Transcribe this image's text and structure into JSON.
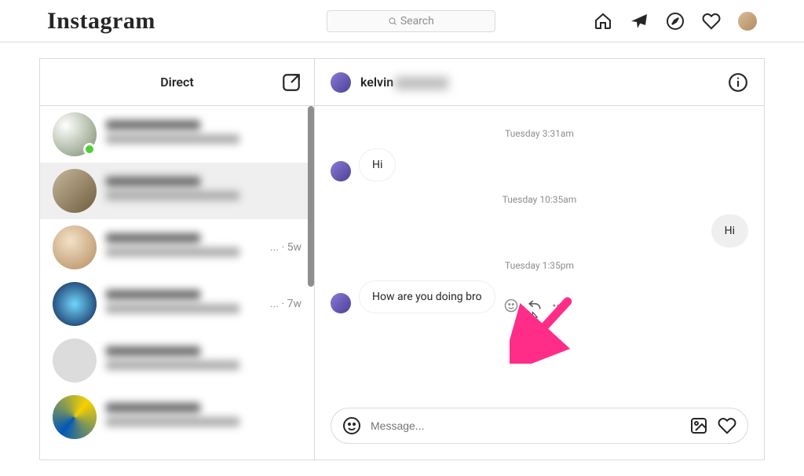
{
  "header": {
    "logo_text": "Instagram",
    "search_placeholder": "Search"
  },
  "sidebar": {
    "title": "Direct",
    "threads": [
      {
        "meta": "",
        "online": true,
        "avatar": "photo1"
      },
      {
        "meta": "",
        "selected": true,
        "avatar": "photo2"
      },
      {
        "meta": "... · 5w",
        "avatar": "photo3"
      },
      {
        "meta": "... · 7w",
        "avatar": "photo4"
      },
      {
        "meta": "",
        "avatar": "blank"
      },
      {
        "meta": "",
        "avatar": "photo5"
      }
    ]
  },
  "chat": {
    "name_visible": "kelvin",
    "timestamps": {
      "t1": "Tuesday 3:31am",
      "t2": "Tuesday 10:35am",
      "t3": "Tuesday 1:35pm"
    },
    "messages": {
      "m1": "Hi",
      "m2": "Hi",
      "m3": "How are you doing bro"
    },
    "composer_placeholder": "Message..."
  }
}
